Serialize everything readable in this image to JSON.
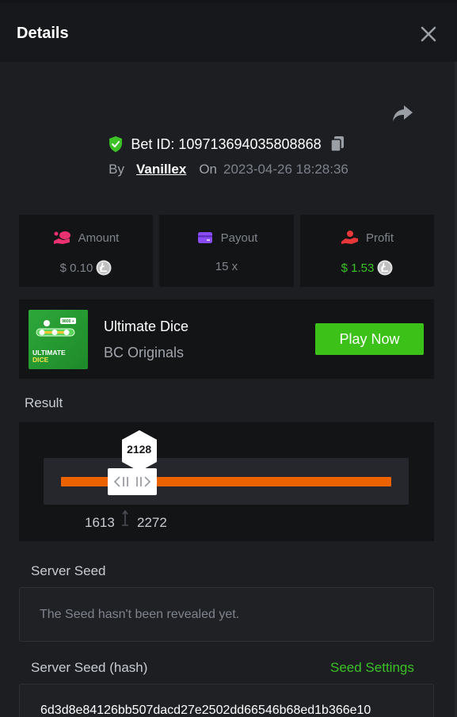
{
  "header": {
    "title": "Details"
  },
  "bet": {
    "id_label": "Bet ID: 109713694035808868",
    "by_label": "By",
    "user": "Vanillex",
    "on_label": "On",
    "date": "2023-04-26 18:28:36"
  },
  "stats": [
    {
      "label": "Amount",
      "value": "$ 0.10",
      "icon": "amount-icon",
      "coin": "litecoin-icon"
    },
    {
      "label": "Payout",
      "value": "15 x",
      "icon": "card-icon"
    },
    {
      "label": "Profit",
      "value": "$ 1.53",
      "icon": "profit-hand-icon",
      "coin": "litecoin-icon"
    }
  ],
  "game": {
    "name": "Ultimate Dice",
    "provider": "BC Originals",
    "play_label": "Play Now",
    "thumb_text_line1": "ULTIMATE",
    "thumb_text_line2": "DICE",
    "thumb_badge": "9800 +"
  },
  "result": {
    "label": "Result",
    "value": "2128",
    "range_low": "1613",
    "range_high": "2272",
    "value_position": 0.215
  },
  "server_seed": {
    "label": "Server Seed",
    "text": "The Seed hasn't been revealed yet."
  },
  "server_seed_hash": {
    "label": "Server Seed (hash)",
    "settings_label": "Seed Settings",
    "hash": "6d3d8e84126bb507dacd27e2502dd66546b68ed1b366e10"
  },
  "colors": {
    "background": "#1c1e22",
    "card": "#131416",
    "accent_green": "#3bc117",
    "track_orange": "#ed6300",
    "amount_icon": "#e9326f",
    "payout_icon": "#8a4df5",
    "profit_icon": "#e6383a"
  }
}
